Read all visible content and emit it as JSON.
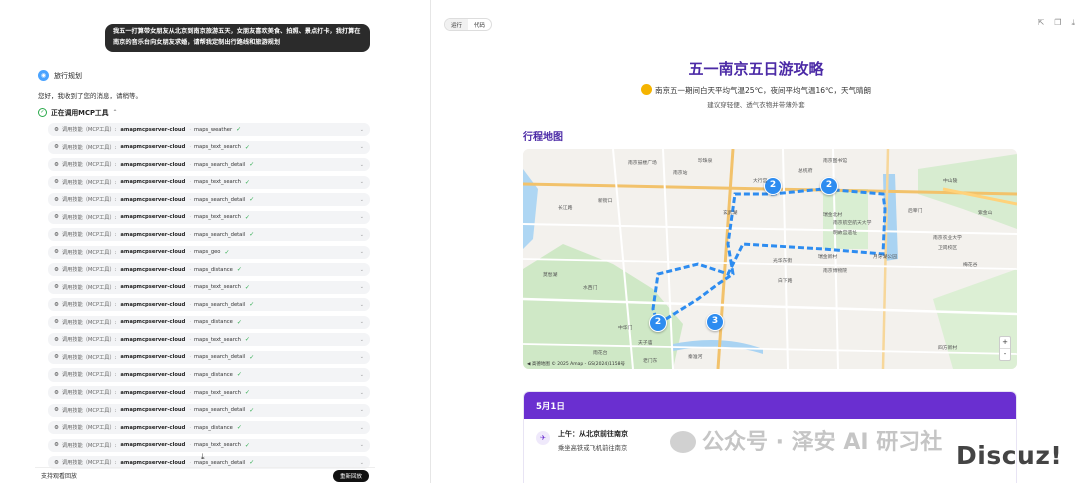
{
  "chat": {
    "user_message": "我五一打算带女朋友从北京到南京旅游五天，女朋友喜欢美食、拍照、景点打卡，我打算在南京的音乐台向女朋友求婚，请帮我定制出行路线和旅游规划",
    "bot_name": "旅行规划",
    "bot_reply": "您好，我收到了您的消息，请稍等。",
    "tool_section_title": "正在调用MCP工具",
    "tool_prefix": "调用技能（MCP工具）:",
    "tool_calls": [
      {
        "server": "amapmcpserver-cloud",
        "name": "maps_weather"
      },
      {
        "server": "amapmcpserver-cloud",
        "name": "maps_text_search"
      },
      {
        "server": "amapmcpserver-cloud",
        "name": "maps_search_detail"
      },
      {
        "server": "amapmcpserver-cloud",
        "name": "maps_text_search"
      },
      {
        "server": "amapmcpserver-cloud",
        "name": "maps_search_detail"
      },
      {
        "server": "amapmcpserver-cloud",
        "name": "maps_text_search"
      },
      {
        "server": "amapmcpserver-cloud",
        "name": "maps_search_detail"
      },
      {
        "server": "amapmcpserver-cloud",
        "name": "maps_geo"
      },
      {
        "server": "amapmcpserver-cloud",
        "name": "maps_distance"
      },
      {
        "server": "amapmcpserver-cloud",
        "name": "maps_text_search"
      },
      {
        "server": "amapmcpserver-cloud",
        "name": "maps_search_detail"
      },
      {
        "server": "amapmcpserver-cloud",
        "name": "maps_distance"
      },
      {
        "server": "amapmcpserver-cloud",
        "name": "maps_text_search"
      },
      {
        "server": "amapmcpserver-cloud",
        "name": "maps_search_detail"
      },
      {
        "server": "amapmcpserver-cloud",
        "name": "maps_distance"
      },
      {
        "server": "amapmcpserver-cloud",
        "name": "maps_text_search"
      },
      {
        "server": "amapmcpserver-cloud",
        "name": "maps_search_detail"
      },
      {
        "server": "amapmcpserver-cloud",
        "name": "maps_distance"
      },
      {
        "server": "amapmcpserver-cloud",
        "name": "maps_text_search"
      },
      {
        "server": "amapmcpserver-cloud",
        "name": "maps_search_detail"
      }
    ],
    "bottom_left": "支持观看回放",
    "bottom_button": "重新回放"
  },
  "preview": {
    "tab_run": "运行",
    "tab_code": "代码",
    "title": "五一南京五日游攻略",
    "weather": "南京五一期间白天平均气温25℃，夜间平均气温16℃，天气晴朗",
    "tip": "建议穿轻便、透气衣物并带薄外套",
    "map_heading": "行程地图",
    "map_attribution": "◀ 高德地图 © 2025 Amap - GS(2024)1158号",
    "zoom_in": "+",
    "zoom_out": "-",
    "markers": [
      "2",
      "2",
      "2",
      "3"
    ],
    "map_labels": [
      "南京鼓楼广场",
      "珍珠泉",
      "南京图书馆",
      "新街口",
      "瑞金北村",
      "南京航空航天大学",
      "明故宫遗址",
      "月牙湖公园",
      "中山陵",
      "南京农业大学",
      "卫岗校区",
      "梅花谷",
      "紫金山",
      "南京博物院",
      "玄武湖",
      "大行宫",
      "总统府",
      "中华门",
      "雨花台",
      "夫子庙",
      "秦淮河",
      "老门东",
      "南京站",
      "长江路",
      "莫愁湖",
      "水西门",
      "白下路",
      "光华东街",
      "瑞金新村",
      "后宰门",
      "四方新村"
    ],
    "day_label": "5月1日",
    "item_title": "上午：从北京前往南京",
    "item_sub": "乘坐高铁或飞机前往南京"
  },
  "watermarks": {
    "wechat": "公众号 · 泽安 AI 研习社",
    "discuz": "Discuz!"
  },
  "icons": {
    "tool": "tool-icon",
    "check": "check-icon",
    "chevron": "chevron-down-icon",
    "share": "share-icon",
    "copy": "copy-icon",
    "download": "download-icon",
    "plane": "plane-icon",
    "sun": "sun-icon"
  },
  "colors": {
    "accent": "#4b2aa6",
    "day_header": "#6a2fd0",
    "route": "#2d8cf0",
    "ok": "#2aa94a"
  }
}
